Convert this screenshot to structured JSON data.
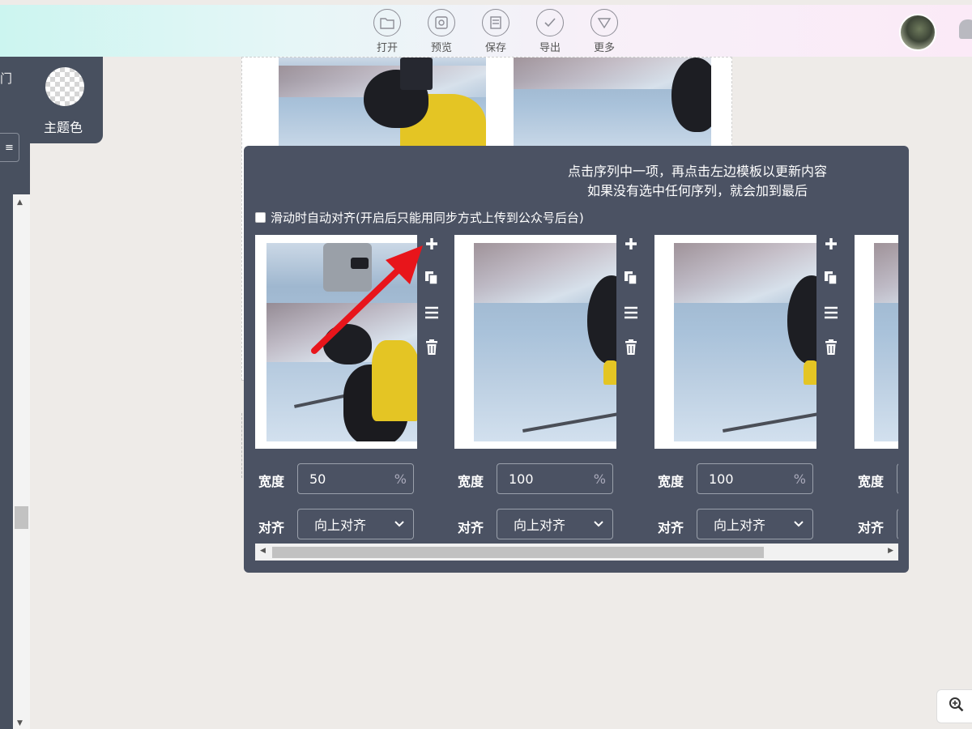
{
  "toolbar": {
    "open": "打开",
    "preview": "预览",
    "save": "保存",
    "export": "导出",
    "more": "更多"
  },
  "left": {
    "partial_text": "门",
    "theme_label": "主题色"
  },
  "panel": {
    "hint_line1": "点击序列中一项，再点击左边模板以更新内容",
    "hint_line2": "如果没有选中任何序列，就会加到最后",
    "auto_align_label": "滑动时自动对齐(开启后只能用同步方式上传到公众号后台)"
  },
  "labels": {
    "width": "宽度",
    "align": "对齐",
    "percent": "%"
  },
  "items": [
    {
      "width_value": "50",
      "align_value": "向上对齐"
    },
    {
      "width_value": "100",
      "align_value": "向上对齐"
    },
    {
      "width_value": "100",
      "align_value": "向上对齐"
    },
    {
      "width_value": "",
      "align_value": ""
    }
  ],
  "colors": {
    "panel_bg": "#4b5263",
    "sidebar_bg": "#48505f",
    "arrow": "#e8151b"
  },
  "icons": {
    "add": "plus-icon",
    "copy": "copy-icon",
    "menu": "menu-icon",
    "delete": "trash-icon",
    "zoom": "zoom-in-icon"
  }
}
